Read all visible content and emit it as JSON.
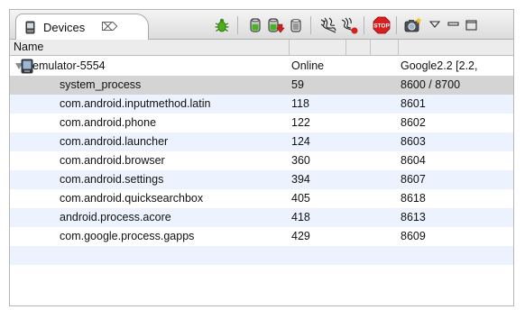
{
  "tab": {
    "title": "Devices",
    "close_glyph": "⌦",
    "icon": "phone-icon"
  },
  "toolbar": {
    "buttons": [
      {
        "name": "debug-process-button",
        "icon": "bug-icon"
      },
      {
        "name": "update-heap-button",
        "icon": "heap-icon"
      },
      {
        "name": "dump-hprof-button",
        "icon": "heap-dump-icon"
      },
      {
        "name": "cause-gc-button",
        "icon": "trash-icon"
      },
      {
        "name": "update-threads-button",
        "icon": "threads-icon"
      },
      {
        "name": "start-method-profiling-button",
        "icon": "method-profiling-icon"
      },
      {
        "name": "stop-process-button",
        "icon": "stop-icon"
      },
      {
        "name": "screen-capture-button",
        "icon": "camera-icon"
      },
      {
        "name": "view-menu-button",
        "icon": "triangle-down-icon"
      },
      {
        "name": "minimize-button",
        "icon": "minimize-icon"
      },
      {
        "name": "maximize-button",
        "icon": "maximize-icon"
      }
    ],
    "stop_label": "STOP"
  },
  "columns": {
    "name": "Name"
  },
  "device": {
    "name": "emulator-5554",
    "state": "Online",
    "target": "Google2.2 [2.2,"
  },
  "processes": [
    {
      "name": "system_process",
      "pid": "59",
      "port": "8600 / 8700"
    },
    {
      "name": "com.android.inputmethod.latin",
      "pid": "118",
      "port": "8601"
    },
    {
      "name": "com.android.phone",
      "pid": "122",
      "port": "8602"
    },
    {
      "name": "com.android.launcher",
      "pid": "124",
      "port": "8603"
    },
    {
      "name": "com.android.browser",
      "pid": "360",
      "port": "8604"
    },
    {
      "name": "com.android.settings",
      "pid": "394",
      "port": "8607"
    },
    {
      "name": "com.android.quicksearchbox",
      "pid": "405",
      "port": "8618"
    },
    {
      "name": "android.process.acore",
      "pid": "418",
      "port": "8613"
    },
    {
      "name": "com.google.process.gapps",
      "pid": "429",
      "port": "8609"
    }
  ],
  "colors": {
    "selected_row": "#d4d4d4",
    "alt_row": "#edf3fe",
    "stop_red": "#d91e1e",
    "bug_green": "#4caf1a"
  }
}
